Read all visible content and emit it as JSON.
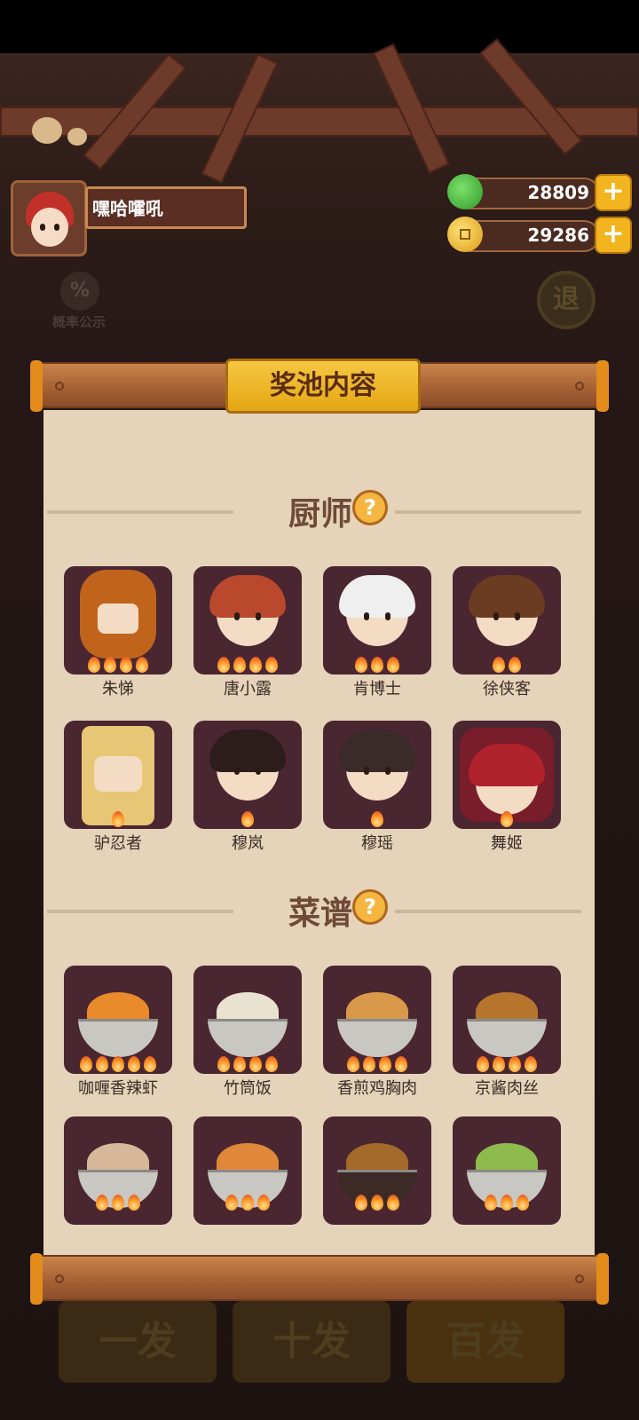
{
  "player": {
    "name": "嘿哈嚯吼"
  },
  "currencies": [
    {
      "icon": "jade-icon",
      "value": "28809",
      "color": "#3fae3a"
    },
    {
      "icon": "gold-coin-icon",
      "value": "29286",
      "color": "#f0b52a"
    }
  ],
  "rate_button": {
    "icon": "%",
    "label": "概率公示"
  },
  "back_button": {
    "label": "退"
  },
  "panel": {
    "title": "奖池内容"
  },
  "sections": [
    {
      "title": "厨师",
      "items": [
        {
          "name": "朱悌",
          "stars": 4
        },
        {
          "name": "唐小露",
          "stars": 4
        },
        {
          "name": "肯博士",
          "stars": 3
        },
        {
          "name": "徐侠客",
          "stars": 2
        },
        {
          "name": "驴忍者",
          "stars": 1
        },
        {
          "name": "穆岚",
          "stars": 1
        },
        {
          "name": "穆瑶",
          "stars": 1
        },
        {
          "name": "舞姬",
          "stars": 1
        }
      ]
    },
    {
      "title": "菜谱",
      "items": [
        {
          "name": "咖喱香辣虾",
          "stars": 5
        },
        {
          "name": "竹筒饭",
          "stars": 4
        },
        {
          "name": "香煎鸡胸肉",
          "stars": 4
        },
        {
          "name": "京酱肉丝",
          "stars": 4
        },
        {
          "name": "",
          "stars": 3
        },
        {
          "name": "",
          "stars": 3
        },
        {
          "name": "",
          "stars": 3
        },
        {
          "name": "",
          "stars": 3
        }
      ]
    }
  ],
  "background_buttons": [
    "一发",
    "十发",
    "百发"
  ]
}
